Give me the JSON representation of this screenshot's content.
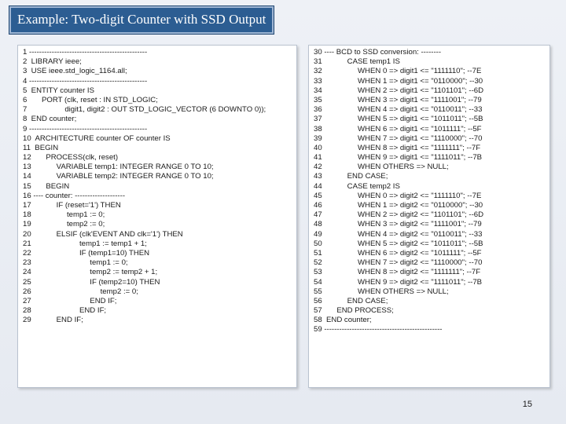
{
  "slide": {
    "title": "Example: Two-digit Counter with SSD Output",
    "page_number": "15"
  },
  "left_column": {
    "lines": [
      "1 -----------------------------------------------",
      "2  LIBRARY ieee;",
      "3  USE ieee.std_logic_1164.all;",
      "4 -----------------------------------------------",
      "5  ENTITY counter IS",
      "6       PORT (clk, reset : IN STD_LOGIC;",
      "7                  digit1, digit2 : OUT STD_LOGIC_VECTOR (6 DOWNTO 0));",
      "8  END counter;",
      "9 -----------------------------------------------",
      "10  ARCHITECTURE counter OF counter IS",
      "11  BEGIN",
      "12       PROCESS(clk, reset)",
      "13            VARIABLE temp1: INTEGER RANGE 0 TO 10;",
      "14            VARIABLE temp2: INTEGER RANGE 0 TO 10;",
      "15       BEGIN",
      "16 ---- counter: --------------------",
      "17            IF (reset='1') THEN",
      "18                 temp1 := 0;",
      "19                 temp2 := 0;",
      "20            ELSIF (clk'EVENT AND clk='1') THEN",
      "21                       temp1 := temp1 + 1;",
      "22                       IF (temp1=10) THEN",
      "23                            temp1 := 0;",
      "24                            temp2 := temp2 + 1;",
      "25                            IF (temp2=10) THEN",
      "26                                 temp2 := 0;",
      "27                            END IF;",
      "28                       END IF;",
      "29            END IF;"
    ]
  },
  "right_column": {
    "lines": [
      "30 ---- BCD to SSD conversion: --------",
      "31            CASE temp1 IS",
      "32                 WHEN 0 => digit1 <= \"1111110\"; --7E",
      "33                 WHEN 1 => digit1 <= \"0110000\"; --30",
      "34                 WHEN 2 => digit1 <= \"1101101\"; --6D",
      "35                 WHEN 3 => digit1 <= \"1111001\"; --79",
      "36                 WHEN 4 => digit1 <= \"0110011\"; --33",
      "37                 WHEN 5 => digit1 <= \"1011011\"; --5B",
      "38                 WHEN 6 => digit1 <= \"1011111\"; --5F",
      "39                 WHEN 7 => digit1 <= \"1110000\"; --70",
      "40                 WHEN 8 => digit1 <= \"1111111\"; --7F",
      "41                 WHEN 9 => digit1 <= \"1111011\"; --7B",
      "42                 WHEN OTHERS => NULL;",
      "43            END CASE;",
      "44            CASE temp2 IS",
      "45                 WHEN 0 => digit2 <= \"1111110\"; --7E",
      "46                 WHEN 1 => digit2 <= \"0110000\"; --30",
      "47                 WHEN 2 => digit2 <= \"1101101\"; --6D",
      "48                 WHEN 3 => digit2 <= \"1111001\"; --79",
      "49                 WHEN 4 => digit2 <= \"0110011\"; --33",
      "50                 WHEN 5 => digit2 <= \"1011011\"; --5B",
      "51                 WHEN 6 => digit2 <= \"1011111\"; --5F",
      "52                 WHEN 7 => digit2 <= \"1110000\"; --70",
      "53                 WHEN 8 => digit2 <= \"1111111\"; --7F",
      "54                 WHEN 9 => digit2 <= \"1111011\"; --7B",
      "55                 WHEN OTHERS => NULL;",
      "56            END CASE;",
      "57       END PROCESS;",
      "58  END counter;",
      "59 -----------------------------------------------"
    ]
  }
}
